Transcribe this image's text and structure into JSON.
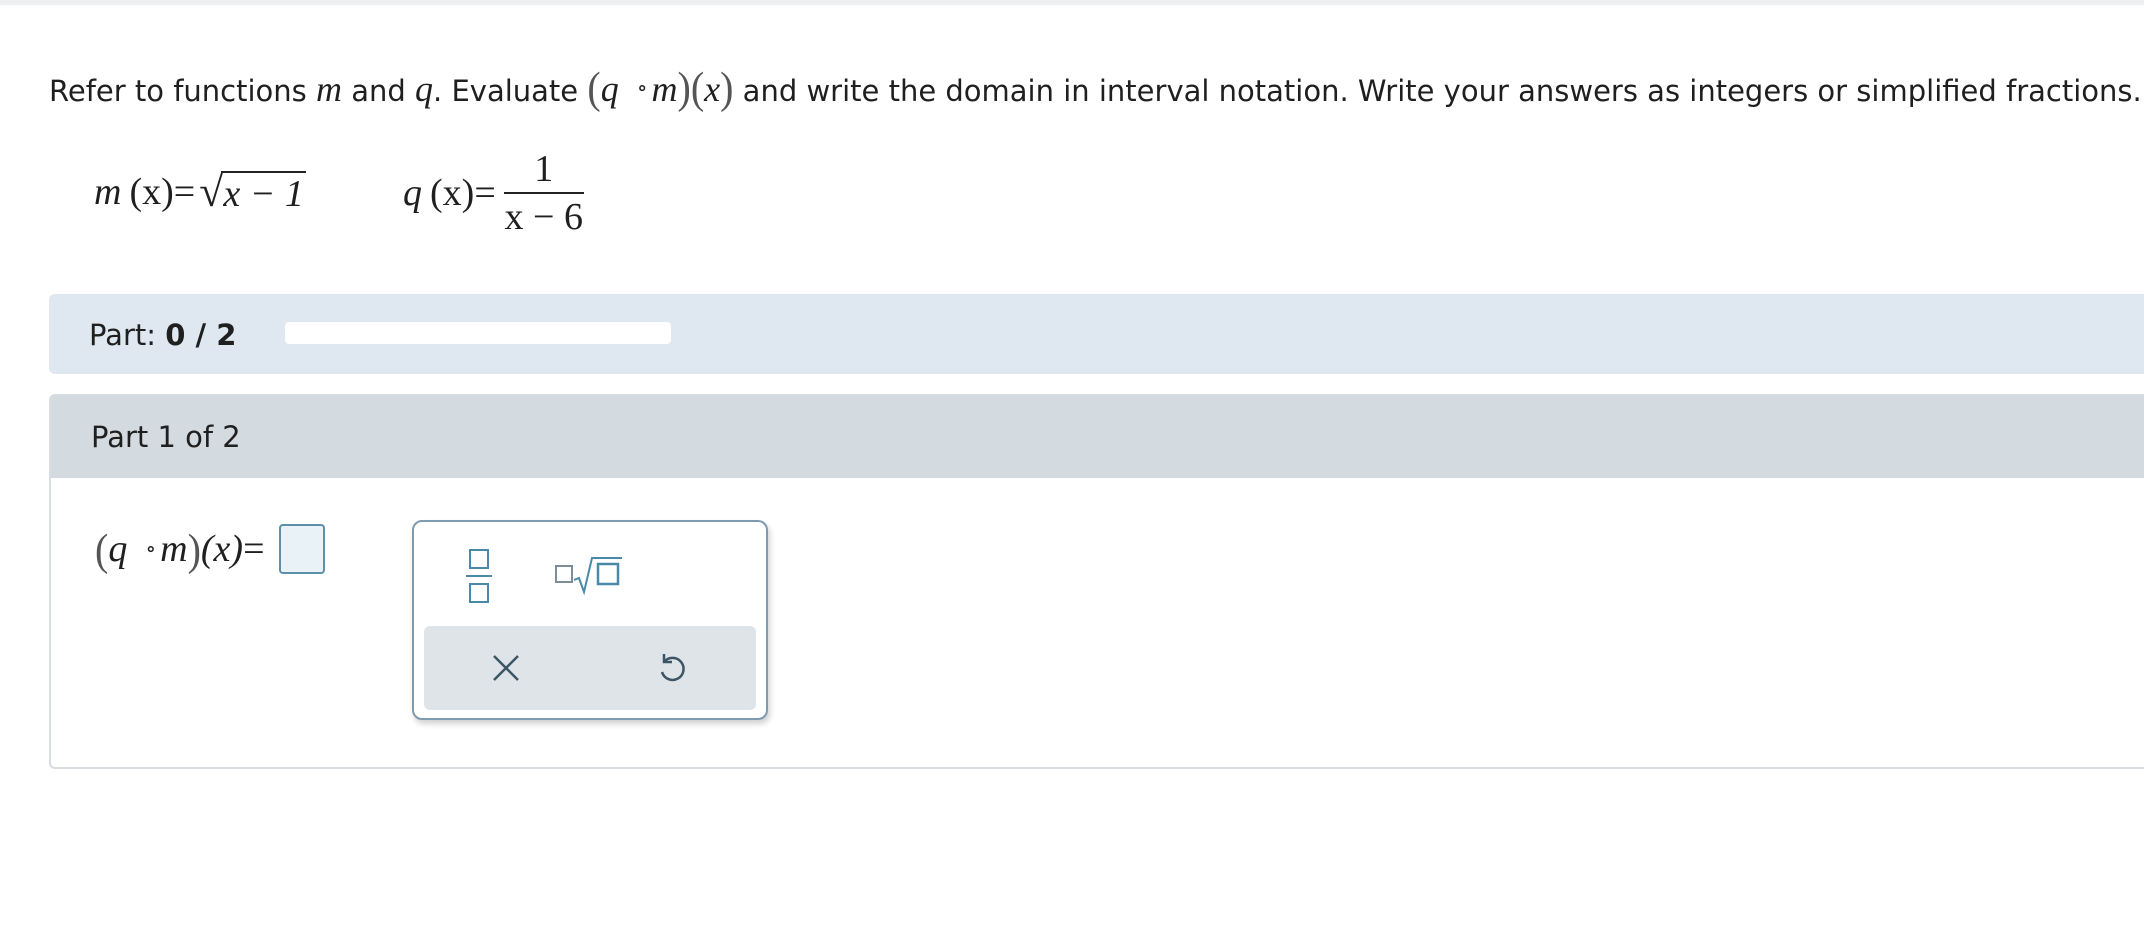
{
  "problem": {
    "text_refer": "Refer to functions",
    "var_m": "m",
    "text_and": "and",
    "var_q": "q",
    "text_evaluate": ". Evaluate",
    "comp_open": "(",
    "comp_q": "q",
    "comp_op": "∘",
    "comp_m": "m",
    "comp_close": ")",
    "comp_x_open": "(",
    "comp_x": "x",
    "comp_x_close": ")",
    "text_rest": "and write the domain in interval notation. Write your answers as integers or simplified fractions."
  },
  "functions": {
    "m": {
      "name": "m",
      "arg": "(x)",
      "equals": "=",
      "radicand": "x − 1"
    },
    "q": {
      "name": "q",
      "arg": "(x)",
      "equals": "=",
      "numerator": "1",
      "denominator": "x − 6"
    }
  },
  "progress": {
    "label": "Part:",
    "value": "0 / 2",
    "fraction": 0
  },
  "part": {
    "title": "Part 1 of 2",
    "answer_label": {
      "open": "(",
      "q": "q",
      "op": "∘",
      "m": "m",
      "close": ")",
      "x": "(x)",
      "equals": "="
    },
    "answer_value": ""
  },
  "keypad": {
    "fraction_key": "fraction-icon",
    "root_key": "nth-root-icon",
    "clear_key": "close-icon",
    "undo_key": "undo-icon"
  },
  "colors": {
    "part_bar": "#dfe7f0",
    "card_header": "#d4dbe0",
    "input_border": "#5e8fa8",
    "icon": "#4a8aa8"
  }
}
